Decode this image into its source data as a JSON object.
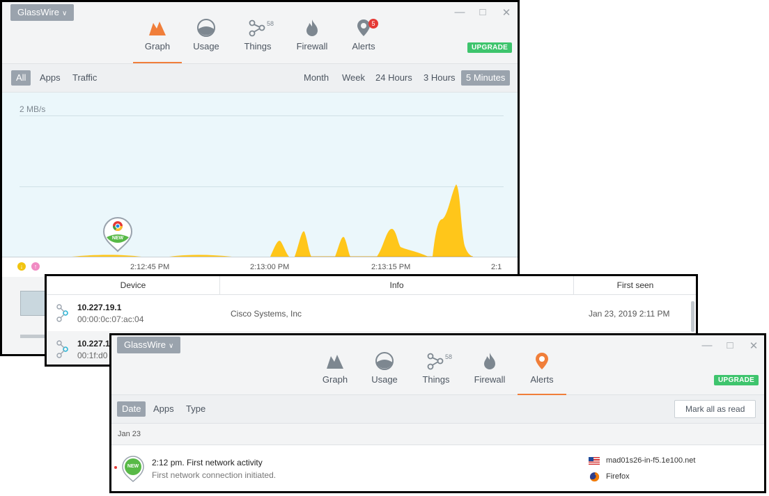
{
  "win1": {
    "app_menu": "GlassWire",
    "tabs": [
      {
        "label": "Graph"
      },
      {
        "label": "Usage"
      },
      {
        "label": "Things",
        "badge": "58"
      },
      {
        "label": "Firewall"
      },
      {
        "label": "Alerts",
        "badge": "5"
      }
    ],
    "upgrade": "UPGRADE",
    "filters_left": [
      "All",
      "Apps",
      "Traffic"
    ],
    "filters_right": [
      "Month",
      "Week",
      "24 Hours",
      "3 Hours",
      "5 Minutes"
    ],
    "graph": {
      "scale_label": "2 MB/s",
      "new_marker": "NEW",
      "time_labels": [
        "2:12:45 PM",
        "2:13:00 PM",
        "2:13:15 PM",
        "2:1"
      ]
    }
  },
  "win2": {
    "columns": [
      "Device",
      "Info",
      "First seen"
    ],
    "rows": [
      {
        "ip": "10.227.19.1",
        "mac": "00:00:0c:07:ac:04",
        "info": "Cisco Systems, Inc",
        "first_seen": "Jan 23, 2019 2:11 PM"
      },
      {
        "ip": "10.227.1",
        "mac": "00:1f:d0",
        "info": "",
        "first_seen": ""
      }
    ]
  },
  "win3": {
    "app_menu": "GlassWire",
    "tabs": [
      {
        "label": "Graph"
      },
      {
        "label": "Usage"
      },
      {
        "label": "Things",
        "badge": "58"
      },
      {
        "label": "Firewall"
      },
      {
        "label": "Alerts"
      }
    ],
    "upgrade": "UPGRADE",
    "filters": [
      "Date",
      "Apps",
      "Type"
    ],
    "mark_all": "Mark all as read",
    "date_group": "Jan 23",
    "alert": {
      "badge": "NEW",
      "title": "2:12 pm. First network activity",
      "subtitle": "First network connection initiated.",
      "host": "mad01s26-in-f5.1e100.net",
      "app": "Firefox"
    }
  },
  "colors": {
    "accent": "#f07e3a",
    "upgrade": "#3ec46d",
    "graph_fill": "#ffc61a",
    "selected": "#9aa3ad"
  }
}
